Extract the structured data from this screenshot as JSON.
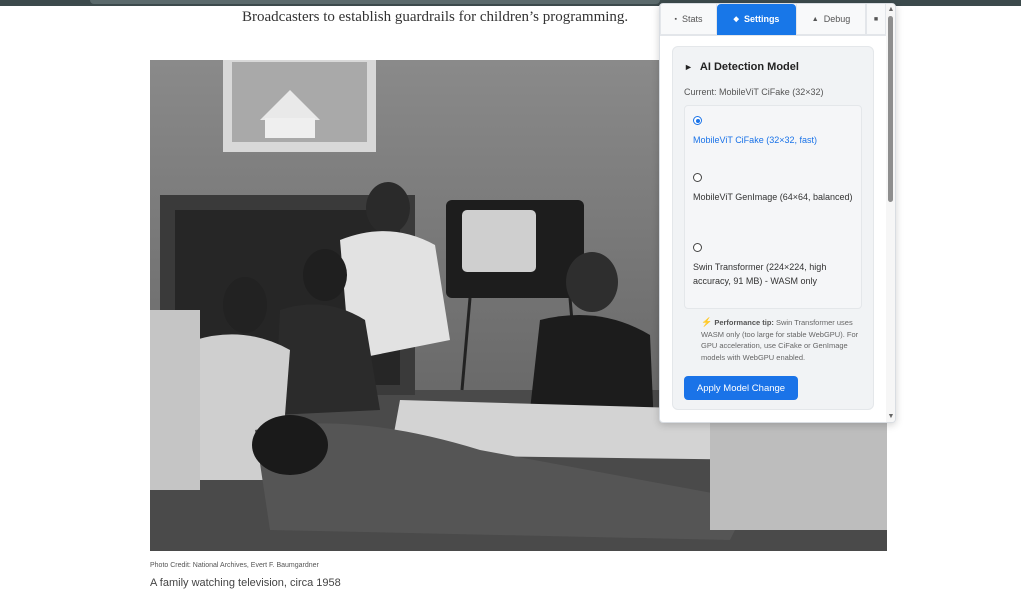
{
  "article": {
    "lead_text": "Broadcasters to establish guardrails for children’s programming."
  },
  "photo": {
    "credit": "Photo Credit:  National Archives, Evert F. Baumgardner",
    "caption": "A family watching television, circa 1958"
  },
  "panel": {
    "tabs": [
      {
        "label": "Stats",
        "icon": "square-icon",
        "active": false
      },
      {
        "label": "Settings",
        "icon": "diamond-icon",
        "active": true
      },
      {
        "label": "Debug",
        "icon": "triangle-icon",
        "active": false
      },
      {
        "label": "",
        "icon": "square-icon",
        "active": false
      }
    ],
    "section": {
      "title": "AI Detection Model",
      "current": "Current: MobileViT CiFake (32×32)",
      "options": [
        {
          "label": "MobileViT CiFake (32×32, fast)",
          "checked": true
        },
        {
          "label": "MobileViT GenImage (64×64, balanced)",
          "checked": false
        },
        {
          "label": "Swin Transformer (224×224, high accuracy, 91 MB) - WASM only",
          "checked": false
        }
      ],
      "tip_title": "Performance tip:",
      "tip_text": " Swin Transformer uses WASM only (too large for stable WebGPU). For GPU acceleration, use CiFake or GenImage models with WebGPU enabled.",
      "apply_label": "Apply Model Change"
    },
    "colors": {
      "accent": "#1a73e8",
      "tip_icon": "#f0883e"
    }
  }
}
